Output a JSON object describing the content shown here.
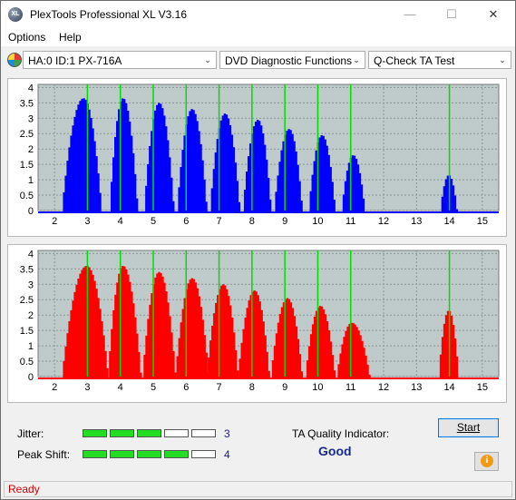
{
  "window": {
    "title": "PlexTools Professional XL V3.16",
    "icon_text": "XL",
    "min_glyph": "—",
    "max_glyph": "☐",
    "close_glyph": "✕"
  },
  "menu": {
    "options": "Options",
    "help": "Help"
  },
  "toolbar": {
    "drive": "HA:0 ID:1  PX-716A",
    "function": "DVD Diagnostic Functions",
    "test": "Q-Check TA Test",
    "arrow_glyph": "⌄"
  },
  "chart_data": [
    {
      "type": "bar",
      "name": "top-chart",
      "color": "#0000ff",
      "x_ticks": [
        "2",
        "3",
        "4",
        "5",
        "6",
        "7",
        "8",
        "9",
        "10",
        "11",
        "12",
        "13",
        "14",
        "15"
      ],
      "y_ticks": [
        "4",
        "3.5",
        "3",
        "2.5",
        "2",
        "1.5",
        "1",
        "0.5",
        "0"
      ],
      "xlim": [
        1.5,
        15.5
      ],
      "ylim": [
        0,
        4.1
      ],
      "grid": true,
      "green_markers": [
        3,
        4,
        5,
        6,
        7,
        8,
        9,
        10,
        11,
        14
      ],
      "peaks": [
        {
          "center": 2.85,
          "height": 3.65,
          "left": 0.65,
          "right": 0.55
        },
        {
          "center": 4.05,
          "height": 3.65,
          "left": 0.4,
          "right": 0.45
        },
        {
          "center": 5.15,
          "height": 3.5,
          "left": 0.45,
          "right": 0.45
        },
        {
          "center": 6.15,
          "height": 3.3,
          "left": 0.45,
          "right": 0.45
        },
        {
          "center": 7.15,
          "height": 3.15,
          "left": 0.45,
          "right": 0.45
        },
        {
          "center": 8.15,
          "height": 2.95,
          "left": 0.45,
          "right": 0.4
        },
        {
          "center": 9.1,
          "height": 2.65,
          "left": 0.45,
          "right": 0.4
        },
        {
          "center": 10.1,
          "height": 2.45,
          "left": 0.4,
          "right": 0.4
        },
        {
          "center": 11.05,
          "height": 1.8,
          "left": 0.35,
          "right": 0.35
        },
        {
          "center": 13.95,
          "height": 1.15,
          "left": 0.25,
          "right": 0.25
        }
      ]
    },
    {
      "type": "bar",
      "name": "bottom-chart",
      "color": "#ff0000",
      "x_ticks": [
        "2",
        "3",
        "4",
        "5",
        "6",
        "7",
        "8",
        "9",
        "10",
        "11",
        "12",
        "13",
        "14",
        "15"
      ],
      "y_ticks": [
        "4",
        "3.5",
        "3",
        "2.5",
        "2",
        "1.5",
        "1",
        "0.5",
        "0"
      ],
      "xlim": [
        1.5,
        15.5
      ],
      "ylim": [
        0,
        4.1
      ],
      "grid": true,
      "green_markers": [
        3,
        4,
        5,
        6,
        7,
        8,
        9,
        10,
        11,
        14
      ],
      "peaks": [
        {
          "center": 2.95,
          "height": 3.6,
          "left": 0.75,
          "right": 0.65
        },
        {
          "center": 4.05,
          "height": 3.6,
          "left": 0.45,
          "right": 0.55
        },
        {
          "center": 5.15,
          "height": 3.4,
          "left": 0.5,
          "right": 0.5
        },
        {
          "center": 6.15,
          "height": 3.2,
          "left": 0.5,
          "right": 0.5
        },
        {
          "center": 7.1,
          "height": 3.0,
          "left": 0.5,
          "right": 0.45
        },
        {
          "center": 8.05,
          "height": 2.8,
          "left": 0.5,
          "right": 0.45
        },
        {
          "center": 9.05,
          "height": 2.55,
          "left": 0.5,
          "right": 0.45
        },
        {
          "center": 10.05,
          "height": 2.3,
          "left": 0.45,
          "right": 0.45
        },
        {
          "center": 11.0,
          "height": 1.75,
          "left": 0.45,
          "right": 0.55
        },
        {
          "center": 13.95,
          "height": 2.15,
          "left": 0.3,
          "right": 0.3
        }
      ]
    }
  ],
  "metrics": {
    "jitter_label": "Jitter:",
    "jitter_value": "3",
    "jitter_level": 3,
    "peak_label": "Peak Shift:",
    "peak_value": "4",
    "peak_level": 4,
    "meter_segments": 5,
    "ta_label": "TA Quality Indicator:",
    "ta_value": "Good"
  },
  "buttons": {
    "start": "Start",
    "info_glyph": "i"
  },
  "status": {
    "text": "Ready"
  }
}
